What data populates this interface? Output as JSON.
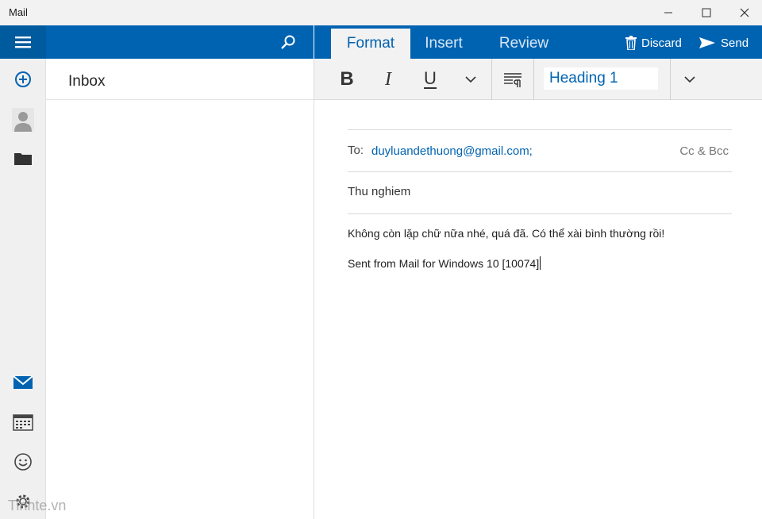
{
  "window": {
    "title": "Mail"
  },
  "folder_pane": {
    "current_folder": "Inbox"
  },
  "compose_tabs": [
    {
      "label": "Format",
      "active": true
    },
    {
      "label": "Insert",
      "active": false
    },
    {
      "label": "Review",
      "active": false
    }
  ],
  "actions": {
    "discard": "Discard",
    "send": "Send"
  },
  "toolbar": {
    "bold": "B",
    "italic": "I",
    "underline": "U",
    "style_value": "Heading 1"
  },
  "message": {
    "to_label": "To:",
    "to_value": "duyluandethuong@gmail.com;",
    "cc_bcc": "Cc & Bcc",
    "subject": "Thu nghiem",
    "body_line1": "Không còn lặp chữ nữa nhé, quá đã. Có thể xài bình thường rồi!",
    "body_line2": "Sent from Mail for Windows 10 [10074]"
  },
  "watermark": "Tinhte.vn",
  "colors": {
    "accent": "#0063b1",
    "accent_dark": "#005a9e",
    "toolbar_bg": "#f2f2f2"
  },
  "icons": {
    "rail": [
      "menu-icon",
      "new-mail-icon",
      "person-icon",
      "folder-icon",
      "mail-icon",
      "calendar-icon",
      "feedback-icon",
      "settings-icon"
    ],
    "header": [
      "search-icon",
      "discard-icon",
      "send-icon"
    ]
  }
}
